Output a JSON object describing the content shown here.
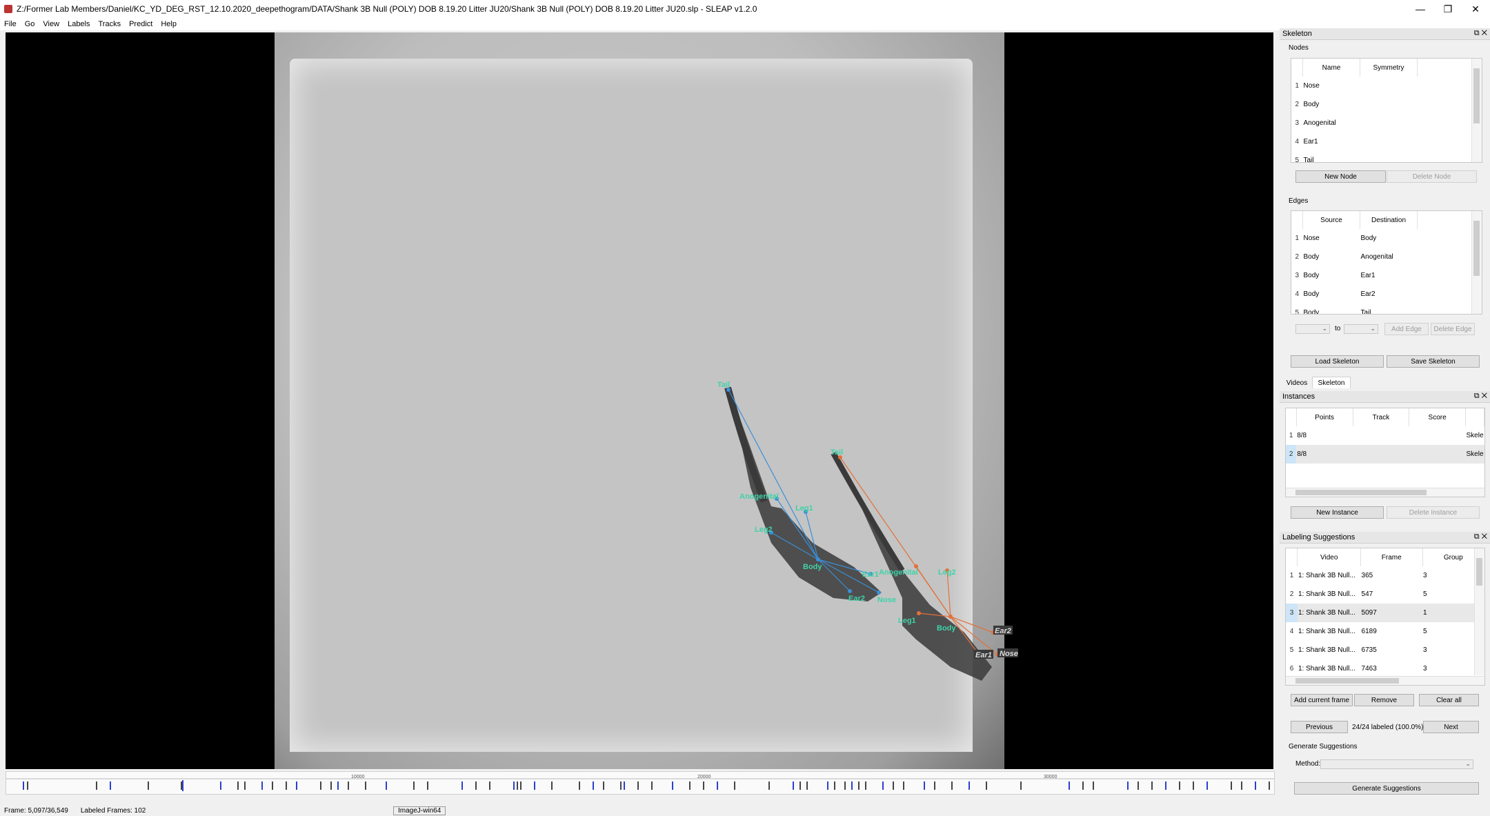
{
  "window": {
    "title": "Z:/Former Lab Members/Daniel/KC_YD_DEG_RST_12.10.2020_deepethogram/DATA/Shank 3B Null (POLY) DOB 8.19.20 Litter JU20/Shank 3B Null (POLY) DOB 8.19.20 Litter JU20.slp - SLEAP v1.2.0",
    "minimize": "—",
    "maximize": "❐",
    "close": "✕"
  },
  "menu": [
    "File",
    "Go",
    "View",
    "Labels",
    "Tracks",
    "Predict",
    "Help"
  ],
  "instances": {
    "blue": {
      "color": "#3a8fd6",
      "label_color": "#3fd2a8",
      "labels": [
        "Tail",
        "Anogenital",
        "Leg1",
        "Leg2",
        "Body",
        "Ear1",
        "Ear2",
        "Nose"
      ]
    },
    "orange": {
      "color": "#e2713a",
      "label_color": "#3fd2a8",
      "labels": [
        "Tail",
        "Anogenital",
        "Leg2",
        "Leg1",
        "Body",
        "Ear2",
        "Ear1",
        "Nose"
      ]
    }
  },
  "timeline": {
    "ticks": [
      "10000",
      "20000",
      "30000"
    ]
  },
  "status": {
    "frame": "Frame: 5,097/36,549",
    "labeled": "Labeled Frames: 102",
    "task_hint": "ImageJ-win64"
  },
  "skeleton_panel": {
    "title": "Skeleton",
    "nodes_label": "Nodes",
    "nodes_headers": [
      "Name",
      "Symmetry"
    ],
    "nodes": [
      {
        "idx": "1",
        "name": "Nose",
        "sym": ""
      },
      {
        "idx": "2",
        "name": "Body",
        "sym": ""
      },
      {
        "idx": "3",
        "name": "Anogenital",
        "sym": ""
      },
      {
        "idx": "4",
        "name": "Ear1",
        "sym": ""
      },
      {
        "idx": "5",
        "name": "Tail",
        "sym": ""
      }
    ],
    "new_node": "New Node",
    "delete_node": "Delete Node",
    "edges_label": "Edges",
    "edges_headers": [
      "Source",
      "Destination"
    ],
    "edges": [
      {
        "idx": "1",
        "src": "Nose",
        "dst": "Body"
      },
      {
        "idx": "2",
        "src": "Body",
        "dst": "Anogenital"
      },
      {
        "idx": "3",
        "src": "Body",
        "dst": "Ear1"
      },
      {
        "idx": "4",
        "src": "Body",
        "dst": "Ear2"
      },
      {
        "idx": "5",
        "src": "Body",
        "dst": "Tail"
      }
    ],
    "to_label": "to",
    "add_edge": "Add Edge",
    "delete_edge": "Delete Edge",
    "load_skeleton": "Load Skeleton",
    "save_skeleton": "Save Skeleton"
  },
  "tabs": [
    "Videos",
    "Skeleton"
  ],
  "instances_panel": {
    "title": "Instances",
    "headers": [
      "Points",
      "Track",
      "Score"
    ],
    "rows": [
      {
        "idx": "1",
        "points": "8/8",
        "track": "",
        "score": "",
        "extra": "Skele"
      },
      {
        "idx": "2",
        "points": "8/8",
        "track": "",
        "score": "",
        "extra": "Skele"
      }
    ],
    "new_instance": "New Instance",
    "delete_instance": "Delete Instance"
  },
  "suggestions_panel": {
    "title": "Labeling Suggestions",
    "headers": [
      "Video",
      "Frame",
      "Group"
    ],
    "rows": [
      {
        "idx": "1",
        "video": "1: Shank 3B Null...",
        "frame": "365",
        "group": "3"
      },
      {
        "idx": "2",
        "video": "1: Shank 3B Null...",
        "frame": "547",
        "group": "5"
      },
      {
        "idx": "3",
        "video": "1: Shank 3B Null...",
        "frame": "5097",
        "group": "1"
      },
      {
        "idx": "4",
        "video": "1: Shank 3B Null...",
        "frame": "6189",
        "group": "5"
      },
      {
        "idx": "5",
        "video": "1: Shank 3B Null...",
        "frame": "6735",
        "group": "3"
      },
      {
        "idx": "6",
        "video": "1: Shank 3B Null...",
        "frame": "7463",
        "group": "3"
      }
    ],
    "add_current": "Add current frame",
    "remove": "Remove",
    "clear_all": "Clear all",
    "previous": "Previous",
    "progress": "24/24 labeled (100.0%)",
    "next": "Next",
    "generate_label": "Generate Suggestions",
    "method_label": "Method:",
    "generate_button": "Generate Suggestions"
  }
}
